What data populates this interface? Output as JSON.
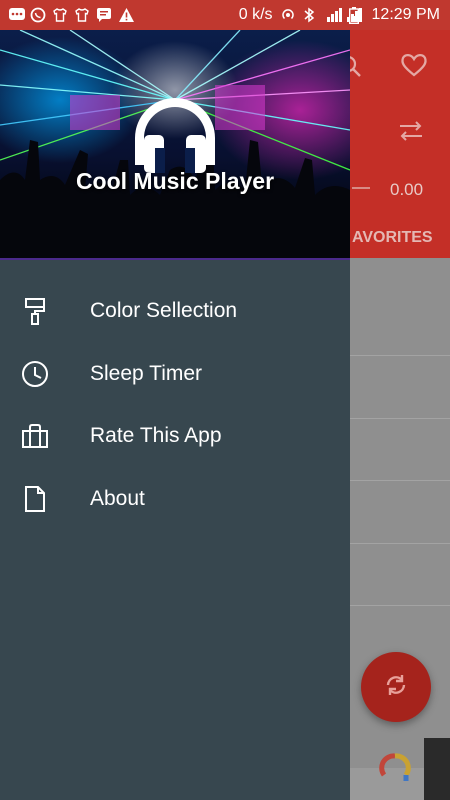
{
  "status_bar": {
    "network_speed": "0 k/s",
    "time": "12:29 PM"
  },
  "background_app": {
    "time_display": "0.00",
    "tab_label": "AVORITES"
  },
  "drawer": {
    "header_title": "Cool Music Player",
    "menu": [
      {
        "label": "Color Sellection",
        "icon": "paint-roller-icon"
      },
      {
        "label": "Sleep Timer",
        "icon": "clock-icon"
      },
      {
        "label": "Rate This App",
        "icon": "shopping-bag-icon"
      },
      {
        "label": "About",
        "icon": "file-icon"
      }
    ]
  },
  "colors": {
    "accent": "#c0382f",
    "drawer_bg": "#37474f",
    "fab": "#a5231c"
  }
}
